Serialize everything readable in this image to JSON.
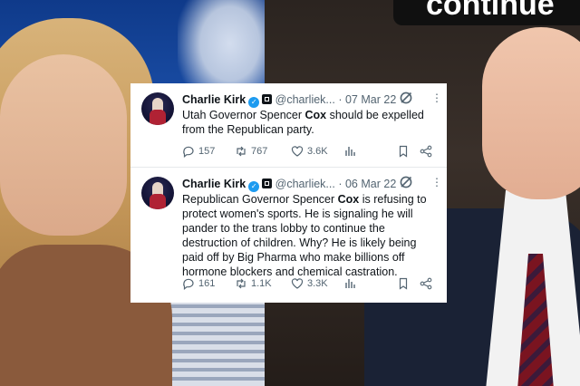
{
  "background": {
    "right_banner_text": "continue"
  },
  "tweets": [
    {
      "name": "Charlie Kirk",
      "handle": "@charliek...",
      "separator": "·",
      "date": "07 Mar 22",
      "text_parts": [
        "Utah Governor Spencer ",
        "Cox",
        " should be expelled from the Republican party."
      ],
      "replies": "157",
      "reposts": "767",
      "likes": "3.6K"
    },
    {
      "name": "Charlie Kirk",
      "handle": "@charliek...",
      "separator": "·",
      "date": "06 Mar 22",
      "text_parts": [
        "Republican Governor Spencer ",
        "Cox",
        " is refusing to protect women's sports. He is signaling he will pander to the trans lobby to continue the destruction of children. Why? He is likely being paid off by Big Pharma who make billions off hormone blockers and chemical castration."
      ],
      "replies": "161",
      "reposts": "1.1K",
      "likes": "3.3K"
    }
  ],
  "icons": {
    "verified": "verified-badge-icon",
    "affiliation": "affiliation-badge-icon",
    "grok": "grok-icon",
    "more": "more-options-icon",
    "reply": "reply-icon",
    "repost": "repost-icon",
    "like": "heart-icon",
    "views": "views-icon",
    "bookmark": "bookmark-icon",
    "share": "share-icon"
  },
  "colors": {
    "verified": "#1d9bf0",
    "text": "#0f1419",
    "muted": "#536471"
  }
}
